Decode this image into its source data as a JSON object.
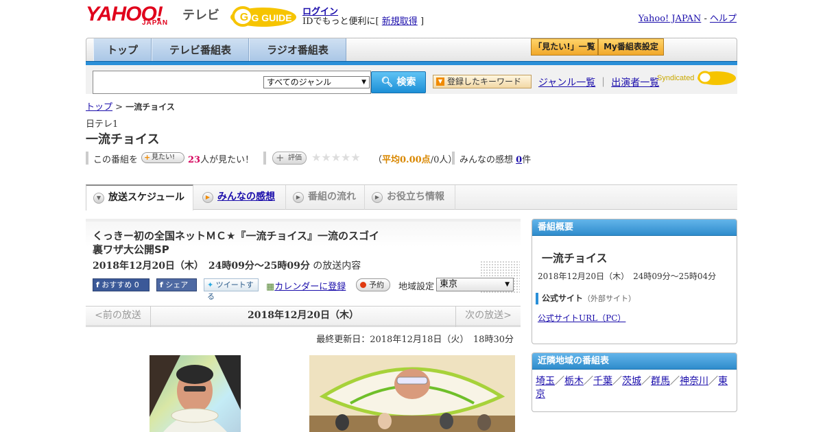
{
  "header": {
    "logo_yahoo": "YAHOO!",
    "logo_japan": "JAPAN",
    "logo_tv": "テレビ",
    "logo_gguide": "G GUIDE",
    "login_link": "ログイン",
    "login_sub_prefix": "IDでもっと便利に[",
    "signup_link": "新規取得",
    "login_sub_suffix": "]",
    "yahoo_japan_link": "Yahoo! JAPAN",
    "separator": " - ",
    "help_link": "ヘルプ"
  },
  "global_nav": {
    "tabs": [
      {
        "label": "トップ"
      },
      {
        "label": "テレビ番組表"
      },
      {
        "label": "ラジオ番組表"
      }
    ],
    "want_list_button": "「見たい!」一覧",
    "my_program_button": "My番組表設定"
  },
  "search": {
    "input_value": "",
    "genre_selected": "すべてのジャンル",
    "search_button": "検索",
    "keyword_button": "登録したキーワード",
    "genre_list_link": "ジャンル一覧",
    "link_separator": "｜",
    "performer_list_link": "出演者一覧",
    "syndicated_label": "Syndicated"
  },
  "breadcrumb": {
    "top_link": "トップ",
    "separator": " > ",
    "current": "一流チョイス"
  },
  "program": {
    "channel": "日テレ1",
    "title": "一流チョイス"
  },
  "stats": {
    "want_prefix": "この番組を",
    "want_button": "見たい!",
    "want_count": "23",
    "want_suffix": "人が見たい！",
    "rate_button": "評価",
    "stars": "★★★★★",
    "rating_open": "（",
    "rating_avg_label": "平均0.00点",
    "rating_count": "/0人）",
    "impressions_prefix": "みんなの感想",
    "impressions_count": "0",
    "impressions_suffix": "件"
  },
  "sub_tabs": [
    {
      "label": "放送スケジュール"
    },
    {
      "label": "みんなの感想"
    },
    {
      "label": "番組の流れ"
    },
    {
      "label": "お役立ち情報"
    }
  ],
  "episode": {
    "title_line1": "くっきー初の全国ネットＭＣ★『一流チョイス』一流のスゴイ",
    "title_line2": "裏ワザ大公開SP",
    "datetime": "2018年12月20日（木）　24時09分～25時09分",
    "datetime_suffix": " の放送内容",
    "fb_recommend": "おすすめ 0",
    "fb_share": "シェア",
    "tweet": "ツイートする",
    "calendar_link": "カレンダーに登録",
    "reserve_button": "予約",
    "region_label": "地域設定",
    "region_selected": "東京"
  },
  "date_nav": {
    "prev": "<前の放送",
    "current": "2018年12月20日（木）",
    "next": "次の放送>"
  },
  "last_updated": "最終更新日：2018年12月18日（火）　18時30分",
  "sidebar": {
    "overview_heading": "番組概要",
    "overview_title": "一流チョイス",
    "overview_time": "2018年12月20日（木）　24時09分～25時04分",
    "official_label": "公式サイト",
    "official_note": "（外部サイト）",
    "official_url_link": "公式サイトURL（PC）",
    "nearby_heading": "近隣地域の番組表",
    "nearby_regions": [
      "埼玉",
      "栃木",
      "千葉",
      "茨城",
      "群馬",
      "神奈川",
      "東京"
    ],
    "nearby_sep": "／"
  },
  "colors": {
    "accent_blue": "#2a8fd8",
    "yahoo_red": "#e0001b",
    "link": "#1a0dab"
  }
}
